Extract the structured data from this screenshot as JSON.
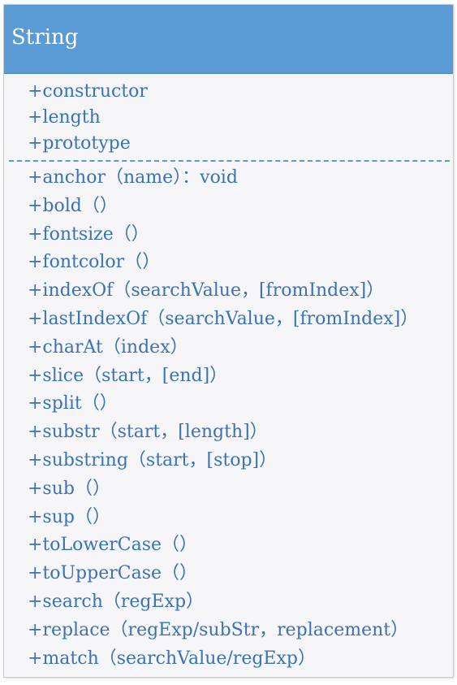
{
  "class": {
    "name": "String",
    "attributes": [
      "+constructor",
      "+length",
      "+prototype"
    ],
    "operations": [
      "+anchor（name）：void",
      "+bold（）",
      "+fontsize（）",
      "+fontcolor（）",
      "+indexOf（searchValue，[fromIndex]）",
      "+lastIndexOf（searchValue，[fromIndex]）",
      "+charAt（index）",
      "+slice（start，[end]）",
      "+split（）",
      "+substr（start，[length]）",
      "+substring（start，[stop]）",
      "+sub（）",
      "+sup（）",
      "+toLowerCase（）",
      "+toUpperCase（）",
      "+search（regExp）",
      "+replace（regExp/subStr，replacement）",
      "+match（searchValue/regExp）"
    ]
  },
  "colors": {
    "header_fill": "#5b9bd5",
    "text": "#3a72b4",
    "body_fill": "#f6f6f8",
    "divider": "#5b9bd5"
  }
}
